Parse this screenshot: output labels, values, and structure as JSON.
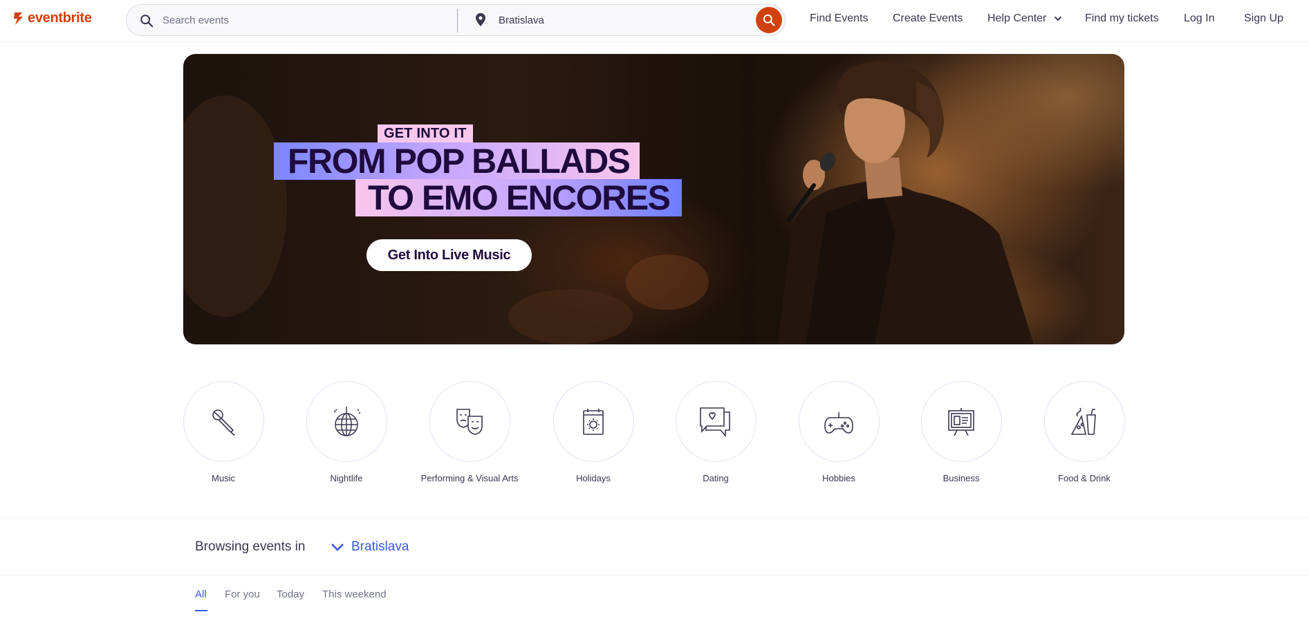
{
  "header": {
    "logo_text": "eventbrite",
    "search_placeholder": "Search events",
    "location_value": "Bratislava",
    "nav": [
      {
        "label": "Find Events"
      },
      {
        "label": "Create Events"
      },
      {
        "label": "Help Center"
      },
      {
        "label": "Find my tickets"
      },
      {
        "label": "Log In"
      },
      {
        "label": "Sign Up"
      }
    ]
  },
  "hero": {
    "kicker": "GET INTO IT",
    "headline_line1": "FROM POP BALLADS",
    "headline_line2": "TO EMO ENCORES",
    "cta_label": "Get Into Live Music"
  },
  "categories": [
    {
      "label": "Music",
      "icon": "microphone-icon"
    },
    {
      "label": "Nightlife",
      "icon": "disco-ball-icon"
    },
    {
      "label": "Performing & Visual Arts",
      "icon": "theater-masks-icon"
    },
    {
      "label": "Holidays",
      "icon": "calendar-sun-icon"
    },
    {
      "label": "Dating",
      "icon": "chat-heart-icon"
    },
    {
      "label": "Hobbies",
      "icon": "gamepad-icon"
    },
    {
      "label": "Business",
      "icon": "presentation-board-icon"
    },
    {
      "label": "Food & Drink",
      "icon": "food-drink-icon"
    }
  ],
  "browsing": {
    "label": "Browsing events in",
    "city": "Bratislava"
  },
  "tabs": [
    {
      "label": "All",
      "active": true
    },
    {
      "label": "For you"
    },
    {
      "label": "Today"
    },
    {
      "label": "This weekend"
    }
  ],
  "colors": {
    "brand": "#d1410c",
    "link_blue": "#3659e3",
    "text": "#39364f"
  }
}
